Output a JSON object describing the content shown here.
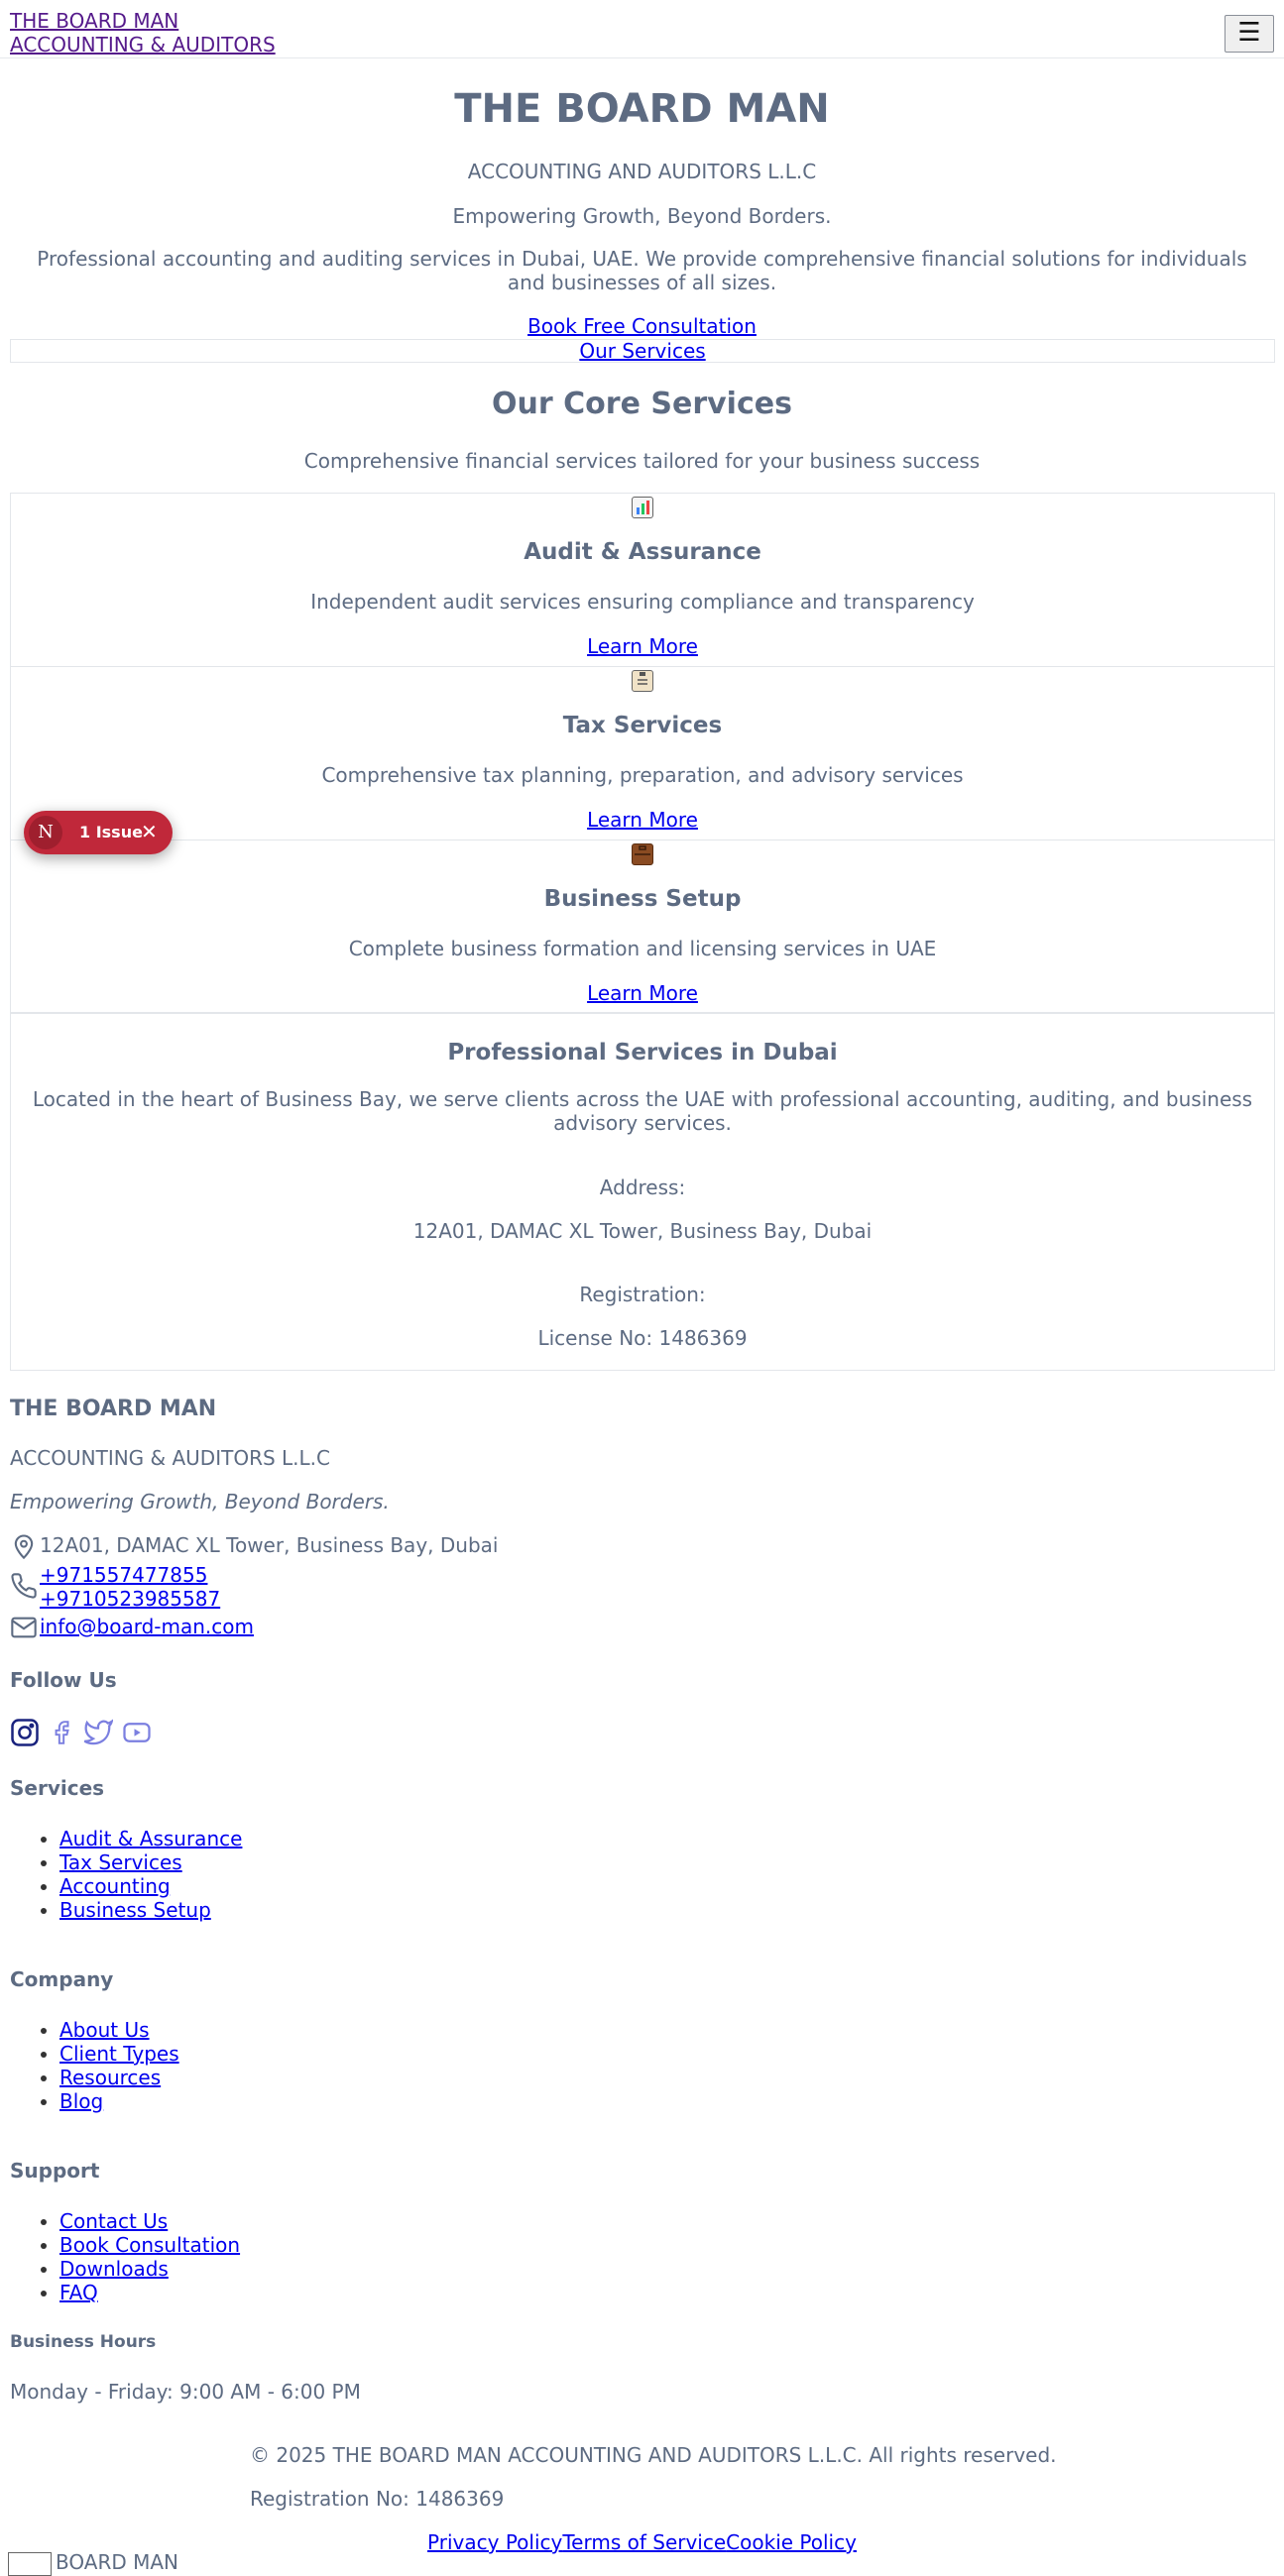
{
  "header": {
    "brand_line1": "THE BOARD MAN",
    "brand_line2": "ACCOUNTING & AUDITORS",
    "menu_icon": "hamburger-icon",
    "menu_glyph": "☰"
  },
  "hero": {
    "title": "THE BOARD MAN",
    "subtitle": "ACCOUNTING AND AUDITORS L.L.C",
    "tagline": "Empowering Growth, Beyond Borders.",
    "description": "Professional accounting and auditing services in Dubai, UAE. We provide comprehensive financial solutions for individuals and businesses of all sizes.",
    "cta_primary": "Book Free Consultation",
    "cta_secondary": "Our Services"
  },
  "services": {
    "title": "Our Core Services",
    "subtitle": "Comprehensive financial services tailored for your business success",
    "cards": [
      {
        "icon": "chart-icon",
        "title": "Audit & Assurance",
        "description": "Independent audit services ensuring compliance and transparency",
        "link": "Learn More"
      },
      {
        "icon": "clipboard-icon",
        "title": "Tax Services",
        "description": "Comprehensive tax planning, preparation, and advisory services",
        "link": "Learn More"
      },
      {
        "icon": "briefcase-icon",
        "title": "Business Setup",
        "description": "Complete business formation and licensing services in UAE",
        "link": "Learn More"
      }
    ]
  },
  "location": {
    "title": "Professional Services in Dubai",
    "description": "Located in the heart of Business Bay, we serve clients across the UAE with professional accounting, auditing, and business advisory services.",
    "address_label": "Address:",
    "address": "12A01, DAMAC XL Tower, Business Bay, Dubai",
    "registration_label": "Registration:",
    "registration": "License No: 1486369"
  },
  "footer": {
    "title": "THE BOARD MAN",
    "subtitle": "ACCOUNTING & AUDITORS L.L.C",
    "tagline": "Empowering Growth, Beyond Borders.",
    "address": "12A01, DAMAC XL Tower, Business Bay, Dubai",
    "phone1": "+971557477855",
    "phone2": "+9710523985587",
    "email": "info@board-man.com",
    "follow_title": "Follow Us",
    "social_icons": [
      "instagram-icon",
      "facebook-icon",
      "twitter-icon",
      "youtube-icon"
    ],
    "services_title": "Services",
    "services_links": [
      "Audit & Assurance",
      "Tax Services",
      "Accounting",
      "Business Setup"
    ],
    "company_title": "Company",
    "company_links": [
      "About Us",
      "Client Types",
      "Resources",
      "Blog"
    ],
    "support_title": "Support",
    "support_links": [
      "Contact Us",
      "Book Consultation",
      "Downloads",
      "FAQ"
    ],
    "hours_title": "Business Hours",
    "hours": "Monday - Friday: 9:00 AM - 6:00 PM",
    "copyright": "© 2025 THE BOARD MAN ACCOUNTING AND AUDITORS L.L.C. All rights reserved.",
    "registration": "Registration No: 1486369",
    "privacy": "Privacy Policy",
    "terms": "Terms of Service",
    "cookie": "Cookie Policy",
    "logo_text": "BOARD MAN"
  },
  "dev_overlay": {
    "badge_letter": "N",
    "label": "1 Issue",
    "close_glyph": "✕",
    "color": "#c0283a"
  },
  "colors": {
    "text": "#5d6b82",
    "link": "#0000ee",
    "visited": "#551a8b"
  }
}
